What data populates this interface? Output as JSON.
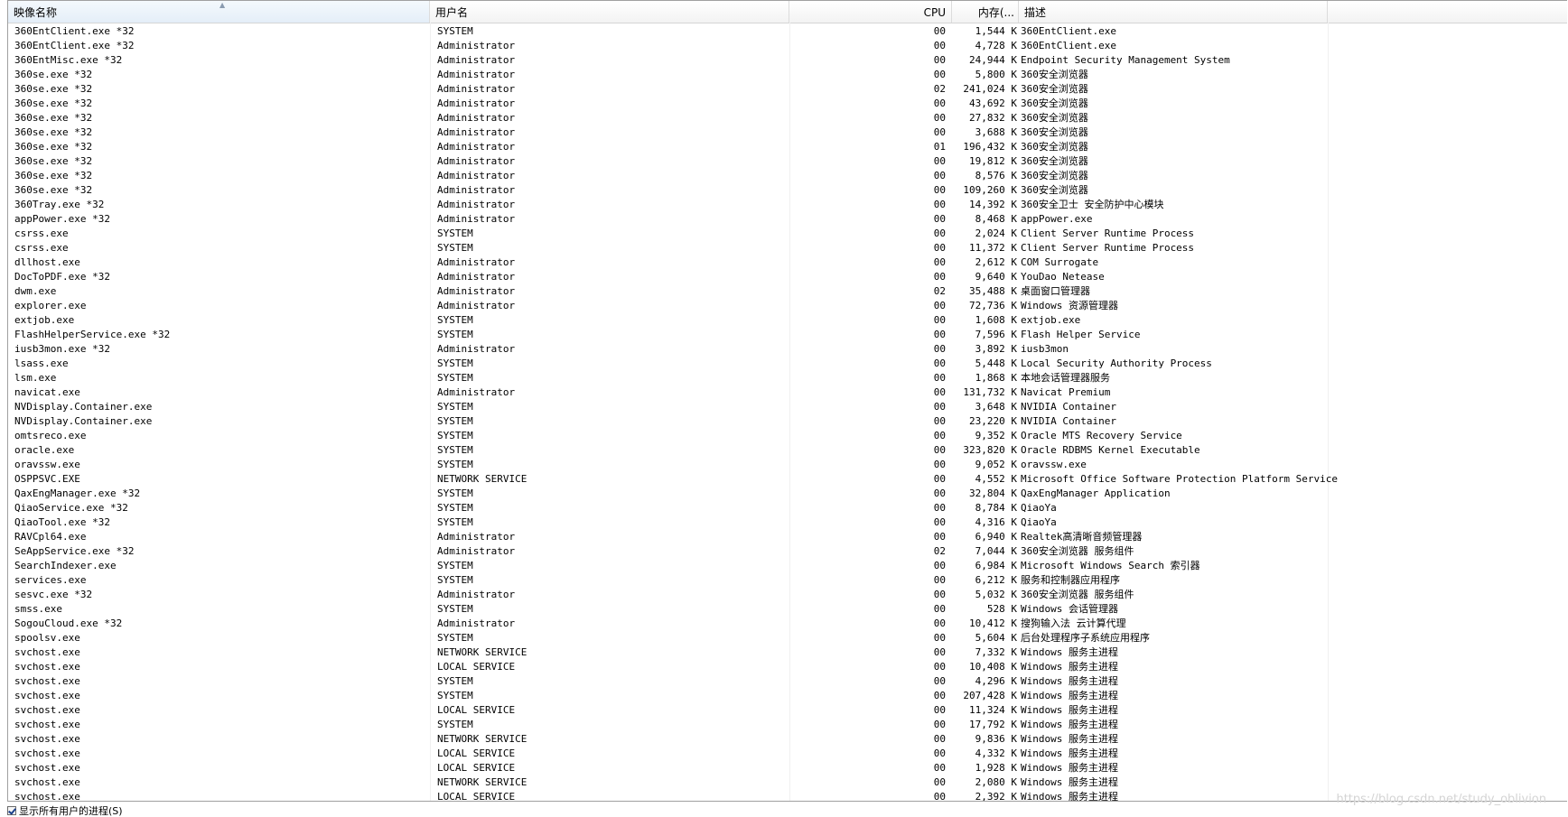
{
  "columns": {
    "name": "映像名称",
    "user": "用户名",
    "cpu": "CPU",
    "memory": "内存(...",
    "description": "描述"
  },
  "rows": [
    {
      "name": "360EntClient.exe *32",
      "user": "SYSTEM",
      "cpu": "00",
      "memory": "1,544 K",
      "description": "360EntClient.exe"
    },
    {
      "name": "360EntClient.exe *32",
      "user": "Administrator",
      "cpu": "00",
      "memory": "4,728 K",
      "description": "360EntClient.exe"
    },
    {
      "name": "360EntMisc.exe *32",
      "user": "Administrator",
      "cpu": "00",
      "memory": "24,944 K",
      "description": "Endpoint Security Management System"
    },
    {
      "name": "360se.exe *32",
      "user": "Administrator",
      "cpu": "00",
      "memory": "5,800 K",
      "description": "360安全浏览器"
    },
    {
      "name": "360se.exe *32",
      "user": "Administrator",
      "cpu": "02",
      "memory": "241,024 K",
      "description": "360安全浏览器"
    },
    {
      "name": "360se.exe *32",
      "user": "Administrator",
      "cpu": "00",
      "memory": "43,692 K",
      "description": "360安全浏览器"
    },
    {
      "name": "360se.exe *32",
      "user": "Administrator",
      "cpu": "00",
      "memory": "27,832 K",
      "description": "360安全浏览器"
    },
    {
      "name": "360se.exe *32",
      "user": "Administrator",
      "cpu": "00",
      "memory": "3,688 K",
      "description": "360安全浏览器"
    },
    {
      "name": "360se.exe *32",
      "user": "Administrator",
      "cpu": "01",
      "memory": "196,432 K",
      "description": "360安全浏览器"
    },
    {
      "name": "360se.exe *32",
      "user": "Administrator",
      "cpu": "00",
      "memory": "19,812 K",
      "description": "360安全浏览器"
    },
    {
      "name": "360se.exe *32",
      "user": "Administrator",
      "cpu": "00",
      "memory": "8,576 K",
      "description": "360安全浏览器"
    },
    {
      "name": "360se.exe *32",
      "user": "Administrator",
      "cpu": "00",
      "memory": "109,260 K",
      "description": "360安全浏览器"
    },
    {
      "name": "360Tray.exe *32",
      "user": "Administrator",
      "cpu": "00",
      "memory": "14,392 K",
      "description": "360安全卫士 安全防护中心模块"
    },
    {
      "name": "appPower.exe *32",
      "user": "Administrator",
      "cpu": "00",
      "memory": "8,468 K",
      "description": "appPower.exe"
    },
    {
      "name": "csrss.exe",
      "user": "SYSTEM",
      "cpu": "00",
      "memory": "2,024 K",
      "description": "Client Server Runtime Process"
    },
    {
      "name": "csrss.exe",
      "user": "SYSTEM",
      "cpu": "00",
      "memory": "11,372 K",
      "description": "Client Server Runtime Process"
    },
    {
      "name": "dllhost.exe",
      "user": "Administrator",
      "cpu": "00",
      "memory": "2,612 K",
      "description": "COM Surrogate"
    },
    {
      "name": "DocToPDF.exe *32",
      "user": "Administrator",
      "cpu": "00",
      "memory": "9,640 K",
      "description": "YouDao Netease"
    },
    {
      "name": "dwm.exe",
      "user": "Administrator",
      "cpu": "02",
      "memory": "35,488 K",
      "description": "桌面窗口管理器"
    },
    {
      "name": "explorer.exe",
      "user": "Administrator",
      "cpu": "00",
      "memory": "72,736 K",
      "description": "Windows 资源管理器"
    },
    {
      "name": "extjob.exe",
      "user": "SYSTEM",
      "cpu": "00",
      "memory": "1,608 K",
      "description": "extjob.exe"
    },
    {
      "name": "FlashHelperService.exe *32",
      "user": "SYSTEM",
      "cpu": "00",
      "memory": "7,596 K",
      "description": "Flash Helper Service"
    },
    {
      "name": "iusb3mon.exe *32",
      "user": "Administrator",
      "cpu": "00",
      "memory": "3,892 K",
      "description": "iusb3mon"
    },
    {
      "name": "lsass.exe",
      "user": "SYSTEM",
      "cpu": "00",
      "memory": "5,448 K",
      "description": "Local Security Authority Process"
    },
    {
      "name": "lsm.exe",
      "user": "SYSTEM",
      "cpu": "00",
      "memory": "1,868 K",
      "description": "本地会话管理器服务"
    },
    {
      "name": "navicat.exe",
      "user": "Administrator",
      "cpu": "00",
      "memory": "131,732 K",
      "description": "Navicat Premium"
    },
    {
      "name": "NVDisplay.Container.exe",
      "user": "SYSTEM",
      "cpu": "00",
      "memory": "3,648 K",
      "description": "NVIDIA Container"
    },
    {
      "name": "NVDisplay.Container.exe",
      "user": "SYSTEM",
      "cpu": "00",
      "memory": "23,220 K",
      "description": "NVIDIA Container"
    },
    {
      "name": "omtsreco.exe",
      "user": "SYSTEM",
      "cpu": "00",
      "memory": "9,352 K",
      "description": "Oracle MTS Recovery Service"
    },
    {
      "name": "oracle.exe",
      "user": "SYSTEM",
      "cpu": "00",
      "memory": "323,820 K",
      "description": "Oracle RDBMS Kernel Executable"
    },
    {
      "name": "oravssw.exe",
      "user": "SYSTEM",
      "cpu": "00",
      "memory": "9,052 K",
      "description": "oravssw.exe"
    },
    {
      "name": "OSPPSVC.EXE",
      "user": "NETWORK SERVICE",
      "cpu": "00",
      "memory": "4,552 K",
      "description": "Microsoft Office Software Protection Platform Service"
    },
    {
      "name": "QaxEngManager.exe *32",
      "user": "SYSTEM",
      "cpu": "00",
      "memory": "32,804 K",
      "description": "QaxEngManager Application"
    },
    {
      "name": "QiaoService.exe *32",
      "user": "SYSTEM",
      "cpu": "00",
      "memory": "8,784 K",
      "description": "QiaoYa"
    },
    {
      "name": "QiaoTool.exe *32",
      "user": "SYSTEM",
      "cpu": "00",
      "memory": "4,316 K",
      "description": "QiaoYa"
    },
    {
      "name": "RAVCpl64.exe",
      "user": "Administrator",
      "cpu": "00",
      "memory": "6,940 K",
      "description": "Realtek高清晰音频管理器"
    },
    {
      "name": "SeAppService.exe *32",
      "user": "Administrator",
      "cpu": "02",
      "memory": "7,044 K",
      "description": "360安全浏览器 服务组件"
    },
    {
      "name": "SearchIndexer.exe",
      "user": "SYSTEM",
      "cpu": "00",
      "memory": "6,984 K",
      "description": "Microsoft Windows Search 索引器"
    },
    {
      "name": "services.exe",
      "user": "SYSTEM",
      "cpu": "00",
      "memory": "6,212 K",
      "description": "服务和控制器应用程序"
    },
    {
      "name": "sesvc.exe *32",
      "user": "Administrator",
      "cpu": "00",
      "memory": "5,032 K",
      "description": "360安全浏览器 服务组件"
    },
    {
      "name": "smss.exe",
      "user": "SYSTEM",
      "cpu": "00",
      "memory": "528 K",
      "description": "Windows 会话管理器"
    },
    {
      "name": "SogouCloud.exe *32",
      "user": "Administrator",
      "cpu": "00",
      "memory": "10,412 K",
      "description": "搜狗输入法 云计算代理"
    },
    {
      "name": "spoolsv.exe",
      "user": "SYSTEM",
      "cpu": "00",
      "memory": "5,604 K",
      "description": "后台处理程序子系统应用程序"
    },
    {
      "name": "svchost.exe",
      "user": "NETWORK SERVICE",
      "cpu": "00",
      "memory": "7,332 K",
      "description": "Windows 服务主进程"
    },
    {
      "name": "svchost.exe",
      "user": "LOCAL SERVICE",
      "cpu": "00",
      "memory": "10,408 K",
      "description": "Windows 服务主进程"
    },
    {
      "name": "svchost.exe",
      "user": "SYSTEM",
      "cpu": "00",
      "memory": "4,296 K",
      "description": "Windows 服务主进程"
    },
    {
      "name": "svchost.exe",
      "user": "SYSTEM",
      "cpu": "00",
      "memory": "207,428 K",
      "description": "Windows 服务主进程"
    },
    {
      "name": "svchost.exe",
      "user": "LOCAL SERVICE",
      "cpu": "00",
      "memory": "11,324 K",
      "description": "Windows 服务主进程"
    },
    {
      "name": "svchost.exe",
      "user": "SYSTEM",
      "cpu": "00",
      "memory": "17,792 K",
      "description": "Windows 服务主进程"
    },
    {
      "name": "svchost.exe",
      "user": "NETWORK SERVICE",
      "cpu": "00",
      "memory": "9,836 K",
      "description": "Windows 服务主进程"
    },
    {
      "name": "svchost.exe",
      "user": "LOCAL SERVICE",
      "cpu": "00",
      "memory": "4,332 K",
      "description": "Windows 服务主进程"
    },
    {
      "name": "svchost.exe",
      "user": "LOCAL SERVICE",
      "cpu": "00",
      "memory": "1,928 K",
      "description": "Windows 服务主进程"
    },
    {
      "name": "svchost.exe",
      "user": "NETWORK SERVICE",
      "cpu": "00",
      "memory": "2,080 K",
      "description": "Windows 服务主进程"
    },
    {
      "name": "svchost.exe",
      "user": "LOCAL SERVICE",
      "cpu": "00",
      "memory": "2,392 K",
      "description": "Windows 服务主进程"
    }
  ],
  "footer": {
    "show_all_users_label": "显示所有用户的进程(S)",
    "show_all_users_checked": true
  },
  "watermark": "https://blog.csdn.net/study_oblivion",
  "sort": {
    "column": "name",
    "icon": "sort-up-icon"
  }
}
